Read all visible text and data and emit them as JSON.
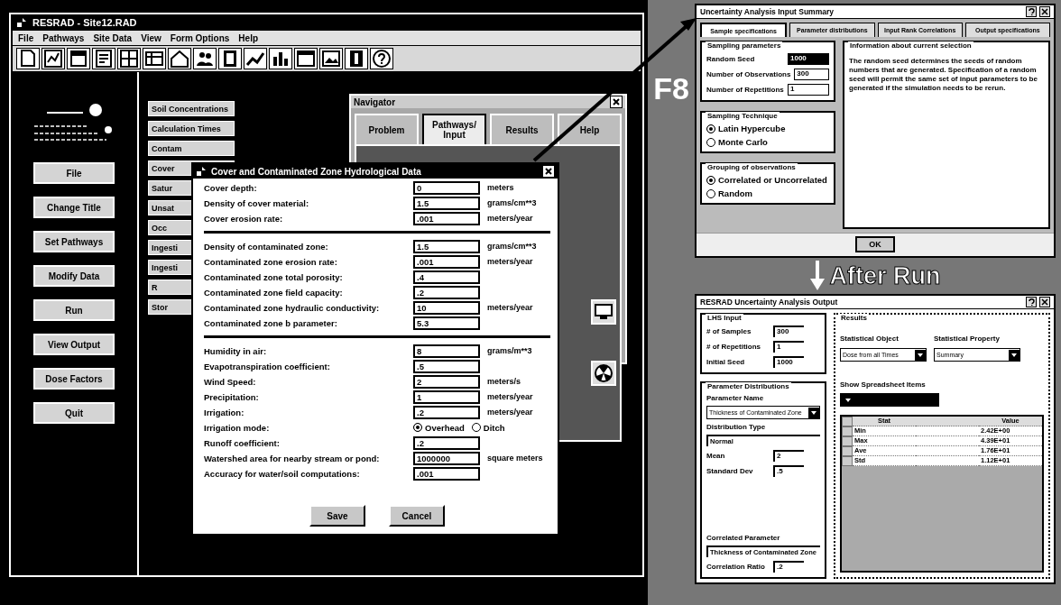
{
  "main_window": {
    "title": "RESRAD - Site12.RAD",
    "menu": [
      "File",
      "Pathways",
      "Site Data",
      "View",
      "Form Options",
      "Help"
    ],
    "side_buttons": [
      "File",
      "Change Title",
      "Set Pathways",
      "Modify Data",
      "Run",
      "View Output",
      "Dose Factors",
      "Quit"
    ],
    "modules": [
      "Soil Concentrations",
      "Calculation Times",
      "Contam",
      "Cover",
      "Satur",
      "Unsat",
      "Occ",
      "Ingesti",
      "Ingesti",
      "R",
      "Stor"
    ]
  },
  "navigator": {
    "title": "Navigator",
    "tabs": [
      {
        "label": "Problem",
        "selected": false
      },
      {
        "label": "Pathways/ Input",
        "selected": true
      },
      {
        "label": "Results",
        "selected": false
      },
      {
        "label": "Help",
        "selected": false
      }
    ]
  },
  "dialog": {
    "title": "Cover and Contaminated Zone Hydrological Data",
    "sections": [
      [
        {
          "kind": "field",
          "label": "Cover depth:",
          "value": "0",
          "unit": "meters"
        },
        {
          "kind": "field",
          "label": "Density of cover material:",
          "value": "1.5",
          "unit": "grams/cm**3"
        },
        {
          "kind": "field",
          "label": "Cover erosion rate:",
          "value": ".001",
          "unit": "meters/year"
        }
      ],
      [
        {
          "kind": "field",
          "label": "Density of contaminated zone:",
          "value": "1.5",
          "unit": "grams/cm**3"
        },
        {
          "kind": "field",
          "label": "Contaminated zone erosion rate:",
          "value": ".001",
          "unit": "meters/year"
        },
        {
          "kind": "field",
          "label": "Contaminated zone total porosity:",
          "value": ".4"
        },
        {
          "kind": "field",
          "label": "Contaminated zone field capacity:",
          "value": ".2"
        },
        {
          "kind": "field",
          "label": "Contaminated zone hydraulic conductivity:",
          "value": "10",
          "unit": "meters/year"
        },
        {
          "kind": "field",
          "label": "Contaminated zone b parameter:",
          "value": "5.3"
        }
      ],
      [
        {
          "kind": "field",
          "label": "Humidity in air:",
          "value": "8",
          "unit": "grams/m**3"
        },
        {
          "kind": "field",
          "label": "Evapotranspiration coefficient:",
          "value": ".5"
        },
        {
          "kind": "field",
          "label": "Wind Speed:",
          "value": "2",
          "unit": "meters/s"
        },
        {
          "kind": "field",
          "label": "Precipitation:",
          "value": "1",
          "unit": "meters/year"
        },
        {
          "kind": "field",
          "label": "Irrigation:",
          "value": ".2",
          "unit": "meters/year"
        },
        {
          "kind": "radio",
          "label": "Irrigation mode:",
          "options": [
            {
              "label": "Overhead",
              "selected": true
            },
            {
              "label": "Ditch",
              "selected": false
            }
          ]
        },
        {
          "kind": "field",
          "label": "Runoff coefficient:",
          "value": ".2"
        },
        {
          "kind": "field",
          "label": "Watershed area for nearby stream or pond:",
          "value": "1000000",
          "unit": "square meters"
        },
        {
          "kind": "field",
          "label": "Accuracy for water/soil computations:",
          "value": ".001"
        }
      ]
    ],
    "buttons": [
      "Save",
      "Cancel"
    ]
  },
  "shortcut_label": "F8",
  "input_window": {
    "title": "Uncertainty Analysis Input Summary",
    "tabs": [
      {
        "label": "Sample specifications",
        "selected": true
      },
      {
        "label": "Parameter distributions",
        "selected": false
      },
      {
        "label": "Input Rank Correlations",
        "selected": false
      },
      {
        "label": "Output specifications",
        "selected": false
      }
    ],
    "sampling": {
      "title": "Sampling parameters",
      "fields": [
        {
          "label": "Random Seed",
          "value": "1000"
        },
        {
          "label": "Number of Observations",
          "value": "300"
        },
        {
          "label": "Number of Repetitions",
          "value": "1"
        }
      ]
    },
    "technique": {
      "title": "Sampling Technique",
      "options": [
        {
          "label": "Latin Hypercube",
          "selected": true
        },
        {
          "label": "Monte Carlo",
          "selected": false
        }
      ]
    },
    "grouping": {
      "title": "Grouping of observations",
      "options": [
        {
          "label": "Correlated or Uncorrelated",
          "selected": true
        },
        {
          "label": "Random",
          "selected": false
        }
      ]
    },
    "info": {
      "title": "Information about current selection",
      "text": "The random seed determines the seeds of random numbers that are generated. Specification of a random seed will permit the same set of input parameters to be generated if the simulation needs to be rerun."
    },
    "ok": "OK"
  },
  "after_run": "After Run",
  "output_window": {
    "title": "RESRAD Uncertainty Analysis Output",
    "lhs": {
      "title": "LHS Input",
      "fields": [
        {
          "label": "# of Samples",
          "value": "300"
        },
        {
          "label": "# of Repetitions",
          "value": "1"
        },
        {
          "label": "Initial Seed",
          "value": "1000"
        }
      ]
    },
    "params": {
      "title": "Parameter Distributions",
      "name_label": "Parameter Name",
      "name_value": "Thickness of Contaminated Zone",
      "dist_label": "Distribution Type",
      "dist_value": "Normal",
      "fields": [
        {
          "label": "Mean",
          "value": "2"
        },
        {
          "label": "Standard Dev",
          "value": ".5"
        }
      ],
      "corr_label": "Correlated Parameter",
      "corr_value": "Thickness of Contaminated Zone",
      "ratio_label": "Correlation Ratio",
      "ratio_value": ".2"
    },
    "results": {
      "title": "Results",
      "object_label": "Statistical Object",
      "object_value": "Dose from all Times",
      "property_label": "Statistical Property",
      "property_value": "Summary",
      "sheet_label": "Show Spreadsheet Items",
      "columns": [
        "Stat",
        "",
        "Value"
      ],
      "rows": [
        [
          "Min",
          "",
          "2.42E+00"
        ],
        [
          "Max",
          "",
          "4.39E+01"
        ],
        [
          "Ave",
          "",
          "1.76E+01"
        ],
        [
          "Std",
          "",
          "1.12E+01"
        ]
      ]
    }
  }
}
